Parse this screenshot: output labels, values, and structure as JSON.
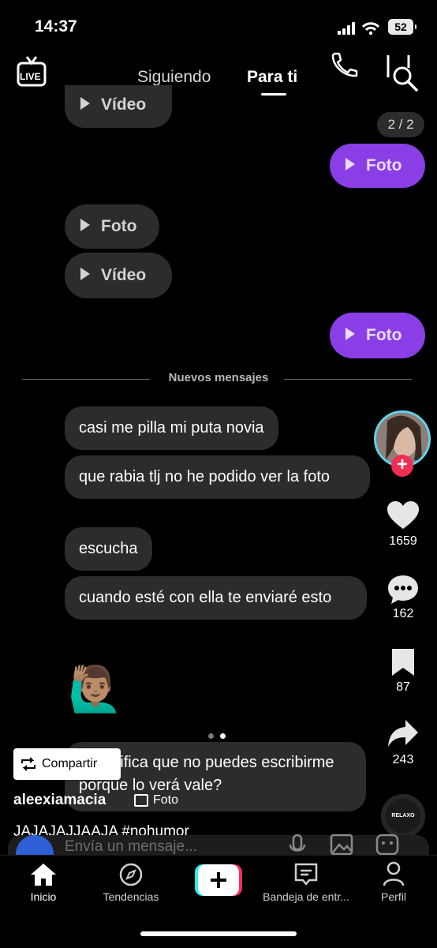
{
  "status": {
    "time": "14:37",
    "battery": "52"
  },
  "top_nav": {
    "live": "LIVE",
    "tab_following": "Siguiendo",
    "tab_for_you": "Para ti"
  },
  "chat": {
    "counter": "2 / 2",
    "media_top": "Vídeo",
    "media_mine_1": "Foto",
    "media_other_1": "Foto",
    "media_other_2": "Vídeo",
    "media_mine_2": "Foto",
    "new_messages": "Nuevos mensajes",
    "messages": [
      "casi me pilla mi puta novia",
      "que rabia tlj no he podido ver la foto",
      "escucha",
      "cuando esté con ella te enviaré esto"
    ],
    "emoji": "🙋🏽‍♂️",
    "partial_msg": "¿Significa que no puedes escribirme porque lo verá vale?"
  },
  "rail": {
    "likes": "1659",
    "comments": "162",
    "saves": "87",
    "shares": "243",
    "music": "RELAXO"
  },
  "post": {
    "share_label": "Compartir",
    "username": "aleexiamacia",
    "photo_tag": "Foto",
    "caption": "JAJAJAJJAAJA #nohumor",
    "input_placeholder": "Envía un mensaje..."
  },
  "bottom_nav": {
    "home": "Inicio",
    "trends": "Tendencias",
    "inbox": "Bandeja de entr...",
    "profile": "Perfil"
  },
  "colors": {
    "accent_purple": "#8a3fe6",
    "like_red": "#ef2d55",
    "ring": "#5fd3e8"
  }
}
